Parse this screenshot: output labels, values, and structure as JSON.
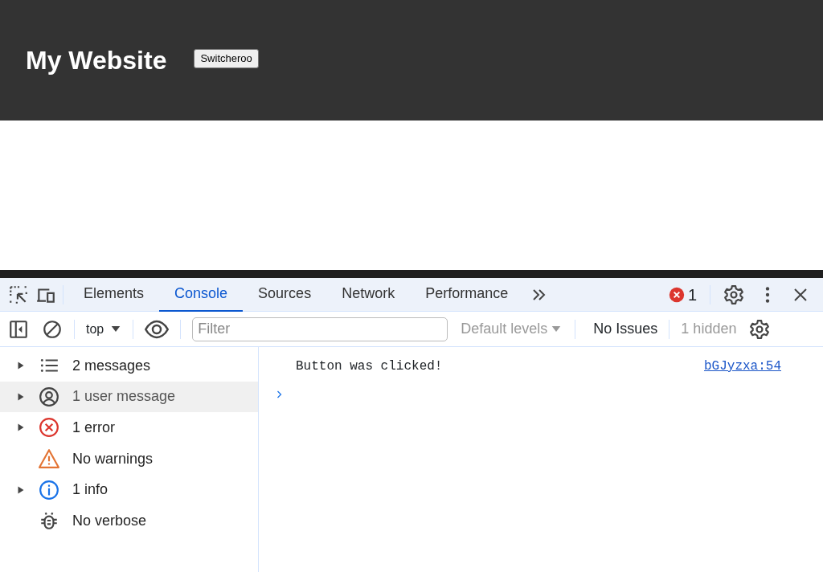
{
  "page": {
    "title": "My Website",
    "button": "Switcheroo"
  },
  "devtools": {
    "tabs": [
      {
        "label": "Elements",
        "selected": false
      },
      {
        "label": "Console",
        "selected": true
      },
      {
        "label": "Sources",
        "selected": false
      },
      {
        "label": "Network",
        "selected": false
      },
      {
        "label": "Performance",
        "selected": false
      }
    ],
    "error_count": "1",
    "context": "top",
    "filter": {
      "placeholder": "Filter"
    },
    "levels": "Default levels",
    "issues": "No Issues",
    "hidden": "1 hidden",
    "sidebar": {
      "items": [
        {
          "label": "2 messages",
          "kind": "messages",
          "expandable": true,
          "selected": false
        },
        {
          "label": "1 user message",
          "kind": "user",
          "expandable": true,
          "selected": true
        },
        {
          "label": "1 error",
          "kind": "error",
          "expandable": true,
          "selected": false
        },
        {
          "label": "No warnings",
          "kind": "warning",
          "expandable": false,
          "selected": false
        },
        {
          "label": "1 info",
          "kind": "info",
          "expandable": true,
          "selected": false
        },
        {
          "label": "No verbose",
          "kind": "verbose",
          "expandable": false,
          "selected": false
        }
      ]
    },
    "console": {
      "messages": [
        {
          "text": "Button was clicked!",
          "source": "bGJyzxa:54"
        }
      ]
    }
  }
}
